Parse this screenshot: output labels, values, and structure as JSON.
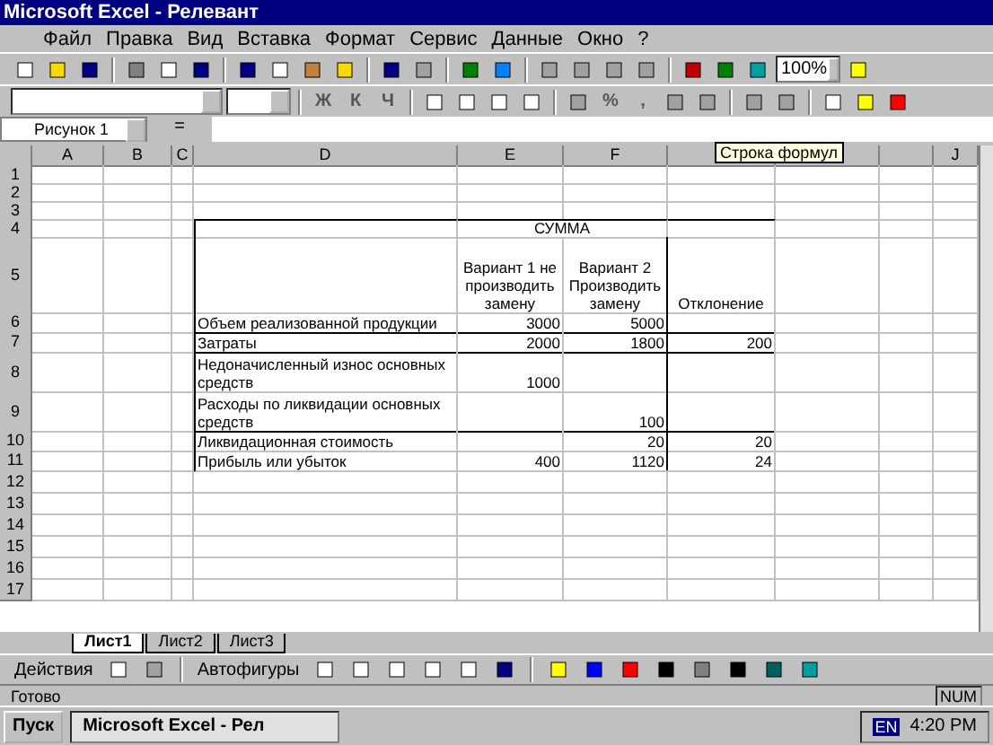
{
  "window": {
    "title": "Microsoft Excel - Релевант"
  },
  "menu": [
    "Файл",
    "Правка",
    "Вид",
    "Вставка",
    "Формат",
    "Сервис",
    "Данные",
    "Окно",
    "?"
  ],
  "zoom": "100%",
  "format_buttons": [
    "Ж",
    "К",
    "Ч"
  ],
  "number_buttons": [
    "%",
    ","
  ],
  "name_box": "Рисунок 1",
  "formula_label": "=",
  "tooltip": "Строка формул",
  "columns": [
    "A",
    "B",
    "C",
    "D",
    "E",
    "F"
  ],
  "last_column": "J",
  "rows": [
    {
      "number": "1"
    },
    {
      "number": "2"
    },
    {
      "number": "3"
    },
    {
      "number": "4",
      "E_F": "СУММА"
    },
    {
      "number": "5",
      "E": "Вариант 1 не производить замену",
      "F": "Вариант 2 Производить замену",
      "G": "Отклонение"
    },
    {
      "number": "6",
      "D": "Объем реализованной продукции",
      "E": "3000",
      "F": "5000"
    },
    {
      "number": "7",
      "D": "Затраты",
      "E": "2000",
      "F": "1800",
      "G": "200"
    },
    {
      "number": "8",
      "D": "Недоначисленный износ основных средств",
      "E": "1000"
    },
    {
      "number": "9",
      "D": "Расходы по ликвидации основных средств",
      "F": "100"
    },
    {
      "number": "10",
      "D": "Ликвидационная стоимость",
      "F": "20",
      "G": "20"
    },
    {
      "number": "11",
      "D": "Прибыль или убыток",
      "E": "400",
      "F": "1120",
      "G": "24"
    },
    {
      "number": "12"
    },
    {
      "number": "13"
    },
    {
      "number": "14"
    },
    {
      "number": "15"
    },
    {
      "number": "16"
    },
    {
      "number": "17"
    }
  ],
  "sheet_tabs": [
    {
      "label": "Лист1",
      "selected": true
    },
    {
      "label": "Лист2",
      "selected": false
    },
    {
      "label": "Лист3",
      "selected": false
    }
  ],
  "drawing_toolbar": {
    "actions": "Действия",
    "autoshapes": "Автофигуры"
  },
  "status_bar": {
    "text": "Готово",
    "num": "NUM"
  },
  "taskbar": {
    "start": "Пуск",
    "task": "Microsoft Excel - Рел",
    "lang": "EN",
    "clock": "4:20 PM"
  }
}
